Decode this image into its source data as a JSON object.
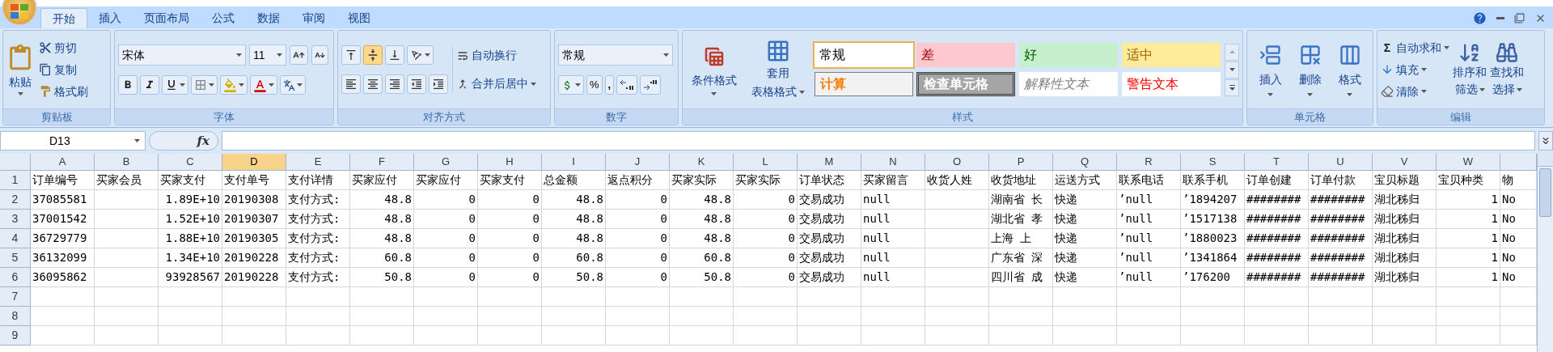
{
  "tabs": [
    {
      "label": "开始",
      "selected": true
    },
    {
      "label": "插入",
      "selected": false
    },
    {
      "label": "页面布局",
      "selected": false
    },
    {
      "label": "公式",
      "selected": false
    },
    {
      "label": "数据",
      "selected": false
    },
    {
      "label": "审阅",
      "selected": false
    },
    {
      "label": "视图",
      "selected": false
    }
  ],
  "clipboard": {
    "title": "剪贴板",
    "paste": "粘贴",
    "cut": "剪切",
    "copy": "复制",
    "painter": "格式刷"
  },
  "font": {
    "title": "字体",
    "family": "宋体",
    "size": "11"
  },
  "alignment": {
    "title": "对齐方式",
    "wrap": "自动换行",
    "merge": "合并后居中",
    "vertical": [
      {
        "selected": false
      },
      {
        "selected": true
      },
      {
        "selected": false
      }
    ]
  },
  "number": {
    "title": "数字",
    "format": "常规",
    "percent": "%",
    "comma": ","
  },
  "styles": {
    "title": "样式",
    "conditional": "条件格式",
    "table_format": [
      "套用",
      "表格格式"
    ],
    "gallery": [
      {
        "label": "常规",
        "kind": "normal",
        "selected": true
      },
      {
        "label": "差",
        "kind": "bad",
        "selected": false
      },
      {
        "label": "好",
        "kind": "good",
        "selected": false
      },
      {
        "label": "适中",
        "kind": "neutral",
        "selected": false
      },
      {
        "label": "计算",
        "kind": "calculation",
        "selected": false
      },
      {
        "label": "检查单元格",
        "kind": "check",
        "selected": false
      },
      {
        "label": "解释性文本",
        "kind": "explanatory",
        "selected": false
      },
      {
        "label": "警告文本",
        "kind": "warning",
        "selected": false
      }
    ]
  },
  "cells": {
    "title": "单元格",
    "actions": [
      "插入",
      "删除",
      "格式"
    ]
  },
  "editing": {
    "title": "编辑",
    "sum_symbol": "Σ",
    "autosum": "自动求和",
    "fill": "填充",
    "clear": "清除",
    "sort": [
      "排序和",
      "筛选"
    ],
    "find": [
      "查找和",
      "选择"
    ]
  },
  "formula_bar": {
    "name_box": "D13",
    "fx": "fx"
  },
  "sheet": {
    "columns": [
      {
        "letter": "A",
        "selected": false,
        "numeric": false
      },
      {
        "letter": "B",
        "selected": false,
        "numeric": false
      },
      {
        "letter": "C",
        "selected": false,
        "numeric": true
      },
      {
        "letter": "D",
        "selected": true,
        "numeric": false
      },
      {
        "letter": "E",
        "selected": false,
        "numeric": false
      },
      {
        "letter": "F",
        "selected": false,
        "numeric": true
      },
      {
        "letter": "G",
        "selected": false,
        "numeric": true
      },
      {
        "letter": "H",
        "selected": false,
        "numeric": true
      },
      {
        "letter": "I",
        "selected": false,
        "numeric": true
      },
      {
        "letter": "J",
        "selected": false,
        "numeric": true
      },
      {
        "letter": "K",
        "selected": false,
        "numeric": true
      },
      {
        "letter": "L",
        "selected": false,
        "numeric": true
      },
      {
        "letter": "M",
        "selected": false,
        "numeric": false
      },
      {
        "letter": "N",
        "selected": false,
        "numeric": false
      },
      {
        "letter": "O",
        "selected": false,
        "numeric": false
      },
      {
        "letter": "P",
        "selected": false,
        "numeric": false
      },
      {
        "letter": "Q",
        "selected": false,
        "numeric": false
      },
      {
        "letter": "R",
        "selected": false,
        "numeric": false
      },
      {
        "letter": "S",
        "selected": false,
        "numeric": false
      },
      {
        "letter": "T",
        "selected": false,
        "numeric": false
      },
      {
        "letter": "U",
        "selected": false,
        "numeric": false
      },
      {
        "letter": "V",
        "selected": false,
        "numeric": false
      },
      {
        "letter": "W",
        "selected": false,
        "numeric": true
      },
      {
        "selected": false
      }
    ],
    "rows": [
      {
        "number": "1",
        "kind": "header",
        "cells": [
          "订单编号",
          "买家会员",
          "买家支付",
          "支付单号",
          "支付详情",
          "买家应付",
          "买家应付",
          "买家支付",
          "总金额",
          "返点积分",
          "买家实际",
          "买家实际",
          "订单状态",
          "买家留言",
          "收货人姓",
          "收货地址",
          "运送方式",
          "联系电话",
          "联系手机",
          "订单创建",
          "订单付款",
          "宝贝标题",
          "宝贝种类",
          "物"
        ]
      },
      {
        "number": "2",
        "kind": "data",
        "cells": [
          "37085581",
          null,
          "1.89E+10",
          "20190308",
          "支付方式:",
          "48.8",
          "0",
          "0",
          "48.8",
          "0",
          "48.8",
          "0",
          "交易成功",
          "null",
          null,
          "湖南省 长",
          "快递",
          "’null",
          "’1894207",
          "########",
          "########",
          "湖北秭归",
          "1",
          "No"
        ]
      },
      {
        "number": "3",
        "kind": "data",
        "cells": [
          "37001542",
          null,
          "1.52E+10",
          "20190307",
          "支付方式:",
          "48.8",
          "0",
          "0",
          "48.8",
          "0",
          "48.8",
          "0",
          "交易成功",
          "null",
          null,
          "湖北省 孝",
          "快递",
          "’null",
          "’1517138",
          "########",
          "########",
          "湖北秭归",
          "1",
          "No"
        ]
      },
      {
        "number": "4",
        "kind": "data",
        "cells": [
          "36729779",
          null,
          "1.88E+10",
          "20190305",
          "支付方式:",
          "48.8",
          "0",
          "0",
          "48.8",
          "0",
          "48.8",
          "0",
          "交易成功",
          "null",
          null,
          "上海 上",
          "快递",
          "’null",
          "’1880023",
          "########",
          "########",
          "湖北秭归",
          "1",
          "No"
        ]
      },
      {
        "number": "5",
        "kind": "data",
        "cells": [
          "36132099",
          null,
          "1.34E+10",
          "20190228",
          "支付方式:",
          "60.8",
          "0",
          "0",
          "60.8",
          "0",
          "60.8",
          "0",
          "交易成功",
          "null",
          null,
          "广东省 深",
          "快递",
          "’null",
          "’1341864",
          "########",
          "########",
          "湖北秭归",
          "1",
          "No"
        ]
      },
      {
        "number": "6",
        "kind": "data",
        "cells": [
          "36095862",
          null,
          "93928567",
          "20190228",
          "支付方式:",
          "50.8",
          "0",
          "0",
          "50.8",
          "0",
          "50.8",
          "0",
          "交易成功",
          "null",
          null,
          "四川省 成",
          "快递",
          "’null",
          "’176200",
          "########",
          "########",
          "湖北秭归",
          "1",
          "No"
        ]
      },
      {
        "number": "7",
        "kind": "data"
      },
      {
        "number": "8",
        "kind": "data"
      },
      {
        "number": "9",
        "kind": "data"
      }
    ]
  }
}
